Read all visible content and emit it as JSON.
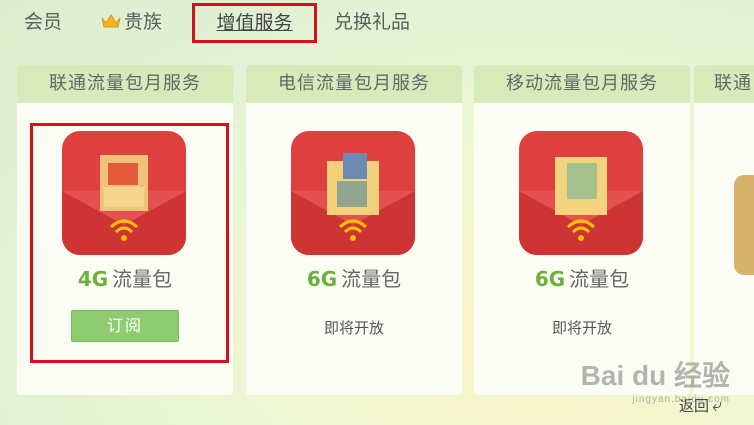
{
  "tabs": {
    "vip": "会员",
    "noble": "贵族",
    "value_added": "增值服务",
    "gifts": "兑换礼品"
  },
  "cards": [
    {
      "title": "联通流量包月服务",
      "size": "4G",
      "unit": "流量包",
      "action": "订阅"
    },
    {
      "title": "电信流量包月服务",
      "size": "6G",
      "unit": "流量包",
      "status": "即将开放"
    },
    {
      "title": "移动流量包月服务",
      "size": "6G",
      "unit": "流量包",
      "status": "即将开放"
    },
    {
      "title": "联通"
    }
  ],
  "watermark": {
    "brand": "Bai du 经验",
    "url": "jingyan.baidu.com"
  },
  "back_label": "返回",
  "colors": {
    "highlight": "#d4101d",
    "green": "#6db13d",
    "icon_red": "#de3f3f"
  }
}
